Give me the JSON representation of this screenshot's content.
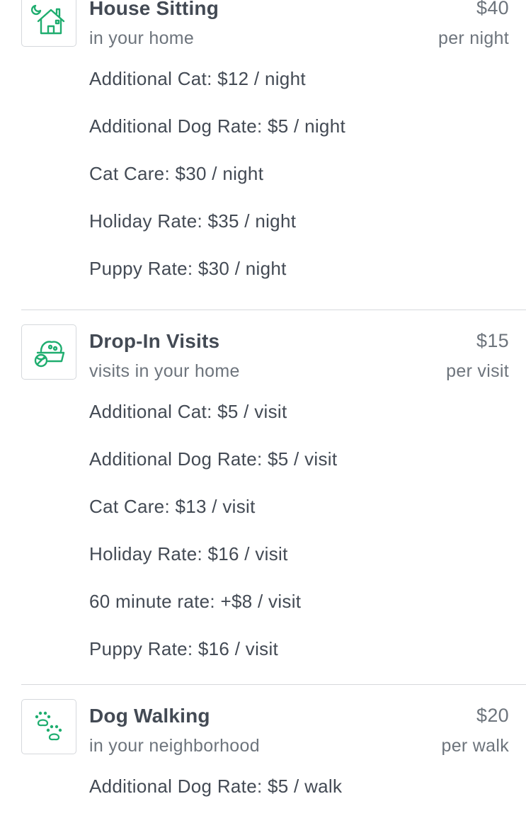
{
  "colors": {
    "accent": "#1fad6f",
    "text": "#434a54",
    "muted": "#6d747c",
    "divider": "#d7d9dc"
  },
  "services": [
    {
      "icon": "house-moon-icon",
      "title": "House Sitting",
      "subtitle": "in your home",
      "price": "$40",
      "unit": "per night",
      "rates": [
        "Additional Cat: $12 / night",
        "Additional Dog Rate: $5 / night",
        "Cat Care: $30 / night",
        "Holiday Rate: $35 / night",
        "Puppy Rate: $30 / night"
      ]
    },
    {
      "icon": "food-bowl-icon",
      "title": "Drop-In Visits",
      "subtitle": "visits in your home",
      "price": "$15",
      "unit": "per visit",
      "rates": [
        "Additional Cat: $5 / visit",
        "Additional Dog Rate: $5 / visit",
        "Cat Care: $13 / visit",
        "Holiday Rate: $16 / visit",
        "60 minute rate: +$8 / visit",
        "Puppy Rate: $16 / visit"
      ]
    },
    {
      "icon": "paw-prints-icon",
      "title": "Dog Walking",
      "subtitle": "in your neighborhood",
      "price": "$20",
      "unit": "per walk",
      "rates": [
        "Additional Dog Rate: $5 / walk"
      ]
    }
  ]
}
